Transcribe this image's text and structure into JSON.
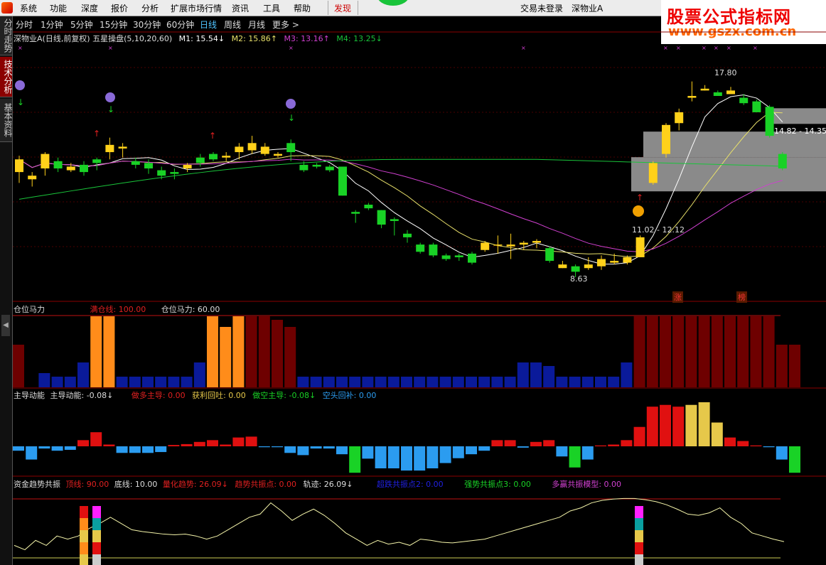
{
  "menubar": {
    "items": [
      "系统",
      "功能",
      "深度",
      "报价",
      "分析",
      "扩展市场行情",
      "资讯",
      "工具",
      "帮助"
    ],
    "find": "发现",
    "login_status": "交易未登录",
    "stock_name": "深物业A"
  },
  "watermark": {
    "title": "股票公式指标网",
    "url": "www.gszx.com.cn"
  },
  "sidebar": {
    "tabs": [
      "分时走势",
      "技术分析",
      "基本资料"
    ],
    "active": "技术分析"
  },
  "periods": {
    "items": [
      "分时",
      "1分钟",
      "5分钟",
      "15分钟",
      "30分钟",
      "60分钟",
      "日线",
      "周线",
      "月线",
      "更多 >"
    ],
    "active": "日线"
  },
  "main_info": {
    "title": "深物业A(日线,前复权) 五星操盘(5,10,20,60)",
    "m1": "M1: 15.54↓",
    "m2": "M2: 15.86↑",
    "m3": "M3: 13.16↑",
    "m4": "M4: 13.25↓"
  },
  "price_labels": {
    "high": "17.80",
    "low": "8.63",
    "zone_low": "11.02 - 12.12",
    "zone_high": "14.82 - 14.35",
    "tag_zhang": "涨",
    "tag_bang": "榜"
  },
  "panel1": {
    "title": "仓位马力",
    "full_line": "满仓线: 100.00",
    "power": "仓位马力: 60.00"
  },
  "panel2": {
    "title": "主导动能",
    "power": "主导动能: -0.08↓",
    "long_lead": "做多主导: 0.00",
    "profit_back": "获利回吐: 0.00",
    "short_lead": "做空主导: -0.08↓",
    "short_cover": "空头回补: 0.00"
  },
  "panel3": {
    "title": "资金趋势共振",
    "top_line": "顶线: 90.00",
    "bottom_line": "底线: 10.00",
    "trend": "量化趋势: 26.09↓",
    "resonance": "趋势共振点: 0.00",
    "track": "轨迹: 26.09↓",
    "super_point": "超跌共振点2: 0.00",
    "strong_point": "强势共振点3: 0.00",
    "multi_model": "多赢共振模型: 0.00"
  },
  "colors": {
    "up": "#ffd11a",
    "down": "#19d226",
    "ma5": "#ffffff",
    "ma10": "#e8e06a",
    "ma20": "#d040d0",
    "ma60": "#19c43a",
    "dark_red": "#6e0000",
    "orange": "#ff8c1a",
    "navy": "#0a1a9a",
    "red": "#e01010",
    "yellow": "#e6c84a",
    "blue": "#2b9cf0"
  },
  "chart_data": {
    "type": "candlestick",
    "candles": [
      [
        11.3,
        12.0,
        10.7,
        12.2
      ],
      [
        10.9,
        11.1,
        10.5,
        11.3
      ],
      [
        11.5,
        12.3,
        11.1,
        12.4
      ],
      [
        11.9,
        11.5,
        11.3,
        12.1
      ],
      [
        11.4,
        11.6,
        11.3,
        11.8
      ],
      [
        11.7,
        11.3,
        11.1,
        11.9
      ],
      [
        12.0,
        11.8,
        11.4,
        12.1
      ],
      [
        12.4,
        12.8,
        12.0,
        13.2
      ],
      [
        12.6,
        12.7,
        12.1,
        12.9
      ],
      [
        11.9,
        11.7,
        11.5,
        12.1
      ],
      [
        11.8,
        11.5,
        11.2,
        12.0
      ],
      [
        11.4,
        11.1,
        10.9,
        11.6
      ],
      [
        11.3,
        11.2,
        10.9,
        11.5
      ],
      [
        11.5,
        11.7,
        11.3,
        11.8
      ],
      [
        12.1,
        11.8,
        11.6,
        12.3
      ],
      [
        12.3,
        12.0,
        11.9,
        12.4
      ],
      [
        12.1,
        12.2,
        11.9,
        12.4
      ],
      [
        12.4,
        12.7,
        12.0,
        12.9
      ],
      [
        12.5,
        12.9,
        12.3,
        13.3
      ],
      [
        12.3,
        12.7,
        12.2,
        12.9
      ],
      [
        12.2,
        12.3,
        12.1,
        12.4
      ],
      [
        12.9,
        12.4,
        11.9,
        13.1
      ],
      [
        11.7,
        11.4,
        11.3,
        11.9
      ],
      [
        11.7,
        11.6,
        11.5,
        11.8
      ],
      [
        11.6,
        11.4,
        11.3,
        11.7
      ],
      [
        11.6,
        10.0,
        10.0,
        11.6
      ],
      [
        9.1,
        9.0,
        8.5,
        9.2
      ],
      [
        9.5,
        9.3,
        9.2,
        9.6
      ],
      [
        9.2,
        8.4,
        8.2,
        9.2
      ],
      [
        8.7,
        8.6,
        7.8,
        8.8
      ],
      [
        7.9,
        7.7,
        7.4,
        8.1
      ],
      [
        7.3,
        6.9,
        6.8,
        7.4
      ],
      [
        7.3,
        6.7,
        6.6,
        7.4
      ],
      [
        6.7,
        6.5,
        6.4,
        6.8
      ],
      [
        6.7,
        6.6,
        6.4,
        6.8
      ],
      [
        6.8,
        6.3,
        6.2,
        6.9
      ],
      [
        7.0,
        7.4,
        6.9,
        7.5
      ],
      [
        7.3,
        7.3,
        6.8,
        7.8
      ],
      [
        7.2,
        7.3,
        6.5,
        7.9
      ],
      [
        7.3,
        7.4,
        7.0,
        7.5
      ],
      [
        7.4,
        7.5,
        7.1,
        7.6
      ],
      [
        7.1,
        6.4,
        6.3,
        7.2
      ],
      [
        6.0,
        6.2,
        6.0,
        6.4
      ],
      [
        6.1,
        5.8,
        5.5,
        6.2
      ],
      [
        6.0,
        6.2,
        5.9,
        6.6
      ],
      [
        6.1,
        6.5,
        5.9,
        6.7
      ],
      [
        6.3,
        6.4,
        6.2,
        6.8
      ],
      [
        6.3,
        6.6,
        6.2,
        6.7
      ],
      [
        6.6,
        7.7,
        6.6,
        7.8
      ],
      [
        10.7,
        11.8,
        10.6,
        11.9
      ],
      [
        12.3,
        13.9,
        12.1,
        14.0
      ],
      [
        14.0,
        14.6,
        13.6,
        14.8
      ],
      [
        15.4,
        15.5,
        15.2,
        16.3
      ],
      [
        15.8,
        15.9,
        15.8,
        16.1
      ],
      [
        15.7,
        15.5,
        15.5,
        15.8
      ],
      [
        15.6,
        15.8,
        15.6,
        16.0
      ],
      [
        15.4,
        15.1,
        15.0,
        15.6
      ],
      [
        15.2,
        14.6,
        14.6,
        15.3
      ],
      [
        14.9,
        13.3,
        13.2,
        15.0
      ],
      [
        12.3,
        11.5,
        11.4,
        12.4
      ]
    ],
    "panel1_bars": [
      [
        60,
        "dark_red"
      ],
      [
        0,
        "none"
      ],
      [
        20,
        "navy"
      ],
      [
        15,
        "navy"
      ],
      [
        15,
        "navy"
      ],
      [
        35,
        "navy"
      ],
      [
        100,
        "orange"
      ],
      [
        100,
        "orange"
      ],
      [
        15,
        "navy"
      ],
      [
        15,
        "navy"
      ],
      [
        15,
        "navy"
      ],
      [
        15,
        "navy"
      ],
      [
        15,
        "navy"
      ],
      [
        15,
        "navy"
      ],
      [
        35,
        "navy"
      ],
      [
        100,
        "orange"
      ],
      [
        85,
        "orange"
      ],
      [
        100,
        "orange"
      ],
      [
        100,
        "dark_red"
      ],
      [
        100,
        "dark_red"
      ],
      [
        95,
        "dark_red"
      ],
      [
        85,
        "dark_red"
      ],
      [
        15,
        "navy"
      ],
      [
        15,
        "navy"
      ],
      [
        15,
        "navy"
      ],
      [
        15,
        "navy"
      ],
      [
        15,
        "navy"
      ],
      [
        15,
        "navy"
      ],
      [
        15,
        "navy"
      ],
      [
        15,
        "navy"
      ],
      [
        15,
        "navy"
      ],
      [
        15,
        "navy"
      ],
      [
        15,
        "navy"
      ],
      [
        15,
        "navy"
      ],
      [
        15,
        "navy"
      ],
      [
        15,
        "navy"
      ],
      [
        15,
        "navy"
      ],
      [
        15,
        "navy"
      ],
      [
        15,
        "navy"
      ],
      [
        35,
        "navy"
      ],
      [
        35,
        "navy"
      ],
      [
        30,
        "navy"
      ],
      [
        15,
        "navy"
      ],
      [
        15,
        "navy"
      ],
      [
        15,
        "navy"
      ],
      [
        15,
        "navy"
      ],
      [
        15,
        "navy"
      ],
      [
        35,
        "navy"
      ],
      [
        100,
        "dark_red"
      ],
      [
        100,
        "dark_red"
      ],
      [
        100,
        "dark_red"
      ],
      [
        100,
        "dark_red"
      ],
      [
        100,
        "dark_red"
      ],
      [
        100,
        "dark_red"
      ],
      [
        100,
        "dark_red"
      ],
      [
        100,
        "dark_red"
      ],
      [
        100,
        "dark_red"
      ],
      [
        100,
        "dark_red"
      ],
      [
        100,
        "dark_red"
      ],
      [
        60,
        "dark_red"
      ],
      [
        60,
        "dark_red"
      ]
    ],
    "panel2_bars": [
      -0.1,
      -0.3,
      -0.05,
      -0.1,
      -0.08,
      0.14,
      0.32,
      0.04,
      -0.15,
      -0.15,
      -0.15,
      -0.13,
      0.03,
      0.05,
      0.1,
      0.14,
      0.04,
      0.2,
      0.22,
      -0.02,
      -0.02,
      -0.15,
      -0.2,
      -0.05,
      -0.05,
      -0.18,
      -0.6,
      -0.28,
      -0.5,
      -0.5,
      -0.55,
      -0.55,
      -0.5,
      -0.38,
      -0.27,
      -0.18,
      -0.1,
      0.14,
      0.14,
      -0.03,
      0.1,
      0.14,
      -0.23,
      -0.48,
      -0.3,
      0.02,
      0.04,
      0.14,
      0.44,
      0.9,
      0.94,
      0.9,
      0.94,
      1.0,
      0.54,
      0.2,
      0.12,
      0.02,
      -0.02,
      -0.3,
      -0.6
    ],
    "panel3_line": [
      20,
      13,
      28,
      20,
      35,
      30,
      35,
      47,
      55,
      65,
      55,
      45,
      42,
      40,
      38,
      37,
      38,
      35,
      30,
      35,
      45,
      55,
      65,
      70,
      88,
      75,
      60,
      70,
      78,
      68,
      55,
      40,
      30,
      20,
      28,
      22,
      25,
      20,
      30,
      28,
      25,
      24,
      26,
      28,
      30,
      35,
      40,
      45,
      50,
      55,
      60,
      65,
      75,
      80,
      88,
      92,
      94,
      95,
      95,
      93,
      90,
      85,
      78,
      70,
      68,
      72,
      80,
      65,
      55,
      40,
      35,
      30,
      26
    ]
  }
}
